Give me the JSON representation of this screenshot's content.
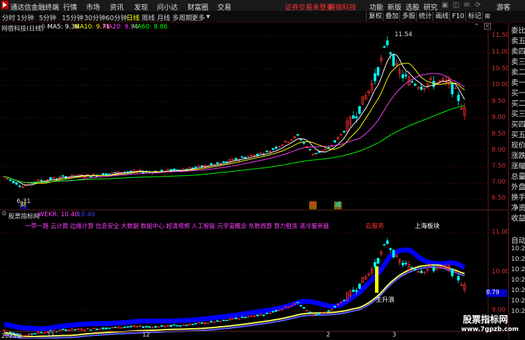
{
  "menu": {
    "app_title": "通达信金融终端",
    "items": [
      "行情",
      "市场",
      "资讯",
      "发现",
      "问小达",
      "财富圈",
      "交易"
    ],
    "login_notice": "证券交易未登录",
    "stock_name": "网宿科技",
    "right_items": [
      "功能",
      "新版",
      "选股",
      "研究"
    ],
    "guest": "游客"
  },
  "toolbar": {
    "periods": [
      "分时",
      "1分钟",
      "5分钟",
      "15分钟",
      "30分钟",
      "60分钟",
      "日线",
      "周线",
      "月线",
      "多周期",
      "更多"
    ],
    "active_period": "日线",
    "right_buttons": [
      "复权",
      "叠加",
      "多股",
      "统计",
      "画线",
      "F10",
      "标记",
      "⊞"
    ]
  },
  "main_chart_header": {
    "title": "网宿科技(日线)",
    "indicators": [
      {
        "label": "MA5: 9.36",
        "color": "#ffffff"
      },
      {
        "label": "MA10: 9.71",
        "color": "#ffff00"
      },
      {
        "label": "MA20: 9.90",
        "color": "#ff40ff"
      },
      {
        "label": "MA60: 8.86",
        "color": "#00ff00"
      }
    ]
  },
  "annotations": {
    "high_label": "11.54",
    "low_label": "6.31",
    "marker_cai": "财",
    "marker_yu": "预",
    "marker_jian": "减"
  },
  "price_axis": [
    "11.50",
    "11.00",
    "10.50",
    "10.00",
    "9.50",
    "9.00",
    "8.50",
    "8.00",
    "7.50",
    "7.00",
    "6.50"
  ],
  "sub_chart_header": {
    "title": "股票指标网",
    "indicator": "WEKR: 10.40",
    "value2": "10.40"
  },
  "concept_line": "一带一路 云计算 边缘计算 信息安全 大数据 数据中心 超清视频 人工智能 元宇宙概念 东数西算 算力租赁 液冷服务器",
  "sub_annotations": {
    "cloud_service": "云服务",
    "shanghai_board": "上海板块",
    "rise_wave": "主升浪",
    "current_value": "8.79"
  },
  "sub_axis": [
    "11.00",
    "10.00",
    "9.00"
  ],
  "sub_right_times": [
    "10:27",
    "10:27",
    "10:27",
    "10:27",
    "10:27",
    "10:27",
    "10:27"
  ],
  "date_axis": [
    "2023年",
    "11",
    "12",
    "2",
    "3"
  ],
  "right_panel": {
    "labels": [
      "委比",
      "卖五",
      "卖四",
      "卖三",
      "卖二",
      "卖一",
      "买一",
      "买二",
      "买三",
      "买四",
      "买五",
      "现价",
      "涨跌",
      "涨幅",
      "总量",
      "外盘",
      "换手",
      "净资",
      "收益"
    ],
    "sub_label": "自动"
  },
  "watermark": {
    "title": "股票指标网",
    "url": "www.7gpzb.com"
  },
  "colors": {
    "up": "#ff3030",
    "down": "#00ffff",
    "ma5": "#ffffff",
    "ma10": "#ffff00",
    "ma20": "#ff40ff",
    "ma60": "#00ff00",
    "band": "#0000ff"
  }
}
